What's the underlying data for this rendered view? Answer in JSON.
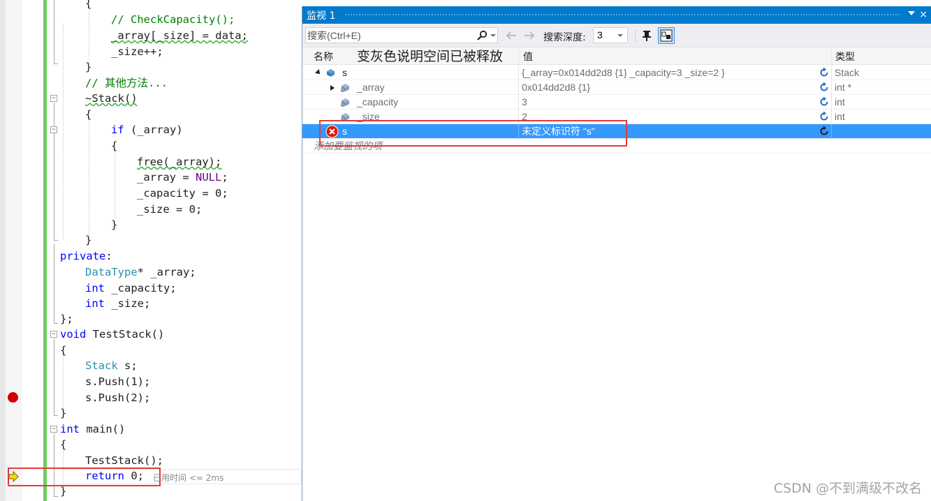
{
  "editor": {
    "lines": [
      {
        "n": 0,
        "parts": [
          {
            "t": "{",
            "c": ""
          }
        ]
      },
      {
        "n": 1,
        "parts": [
          {
            "t": "// CheckCapacity();",
            "c": "cm"
          }
        ]
      },
      {
        "n": 2,
        "parts": [
          {
            "t": "_array[_size] = data;",
            "c": ""
          }
        ]
      },
      {
        "n": 3,
        "parts": [
          {
            "t": "_size++;",
            "c": ""
          }
        ]
      },
      {
        "n": 4,
        "parts": [
          {
            "t": "}",
            "c": ""
          }
        ]
      },
      {
        "n": 5,
        "parts": [
          {
            "t": "// 其他方法...",
            "c": "cm"
          }
        ]
      },
      {
        "n": 6,
        "parts": [
          {
            "t": "~Stack()",
            "c": ""
          }
        ]
      },
      {
        "n": 7,
        "parts": [
          {
            "t": "{",
            "c": ""
          }
        ]
      },
      {
        "n": 8,
        "parts": [
          {
            "t": "if",
            "c": "kw"
          },
          {
            "t": " (_array)",
            "c": ""
          }
        ]
      },
      {
        "n": 9,
        "parts": [
          {
            "t": "{",
            "c": ""
          }
        ]
      },
      {
        "n": 10,
        "parts": [
          {
            "t": "free(_array);",
            "c": ""
          }
        ]
      },
      {
        "n": 11,
        "parts": [
          {
            "t": "_array = ",
            "c": ""
          },
          {
            "t": "NULL",
            "c": "mac"
          },
          {
            "t": ";",
            "c": ""
          }
        ]
      },
      {
        "n": 12,
        "parts": [
          {
            "t": "_capacity = 0;",
            "c": ""
          }
        ]
      },
      {
        "n": 13,
        "parts": [
          {
            "t": "_size = 0;",
            "c": ""
          }
        ]
      },
      {
        "n": 14,
        "parts": [
          {
            "t": "}",
            "c": ""
          }
        ]
      },
      {
        "n": 15,
        "parts": [
          {
            "t": "}",
            "c": ""
          }
        ]
      },
      {
        "n": 16,
        "parts": [
          {
            "t": "private",
            "c": "kw"
          },
          {
            "t": ":",
            "c": ""
          }
        ]
      },
      {
        "n": 17,
        "parts": [
          {
            "t": "DataType",
            "c": "ty"
          },
          {
            "t": "* _array;",
            "c": ""
          }
        ]
      },
      {
        "n": 18,
        "parts": [
          {
            "t": "int",
            "c": "kw"
          },
          {
            "t": " _capacity;",
            "c": ""
          }
        ]
      },
      {
        "n": 19,
        "parts": [
          {
            "t": "int",
            "c": "kw"
          },
          {
            "t": " _size;",
            "c": ""
          }
        ]
      },
      {
        "n": 20,
        "parts": [
          {
            "t": "};",
            "c": ""
          }
        ]
      },
      {
        "n": 21,
        "parts": [
          {
            "t": "void",
            "c": "kw"
          },
          {
            "t": " TestStack()",
            "c": ""
          }
        ]
      },
      {
        "n": 22,
        "parts": [
          {
            "t": "{",
            "c": ""
          }
        ]
      },
      {
        "n": 23,
        "parts": [
          {
            "t": "Stack",
            "c": "ty"
          },
          {
            "t": " s;",
            "c": ""
          }
        ]
      },
      {
        "n": 24,
        "parts": [
          {
            "t": "s.Push(1);",
            "c": ""
          }
        ]
      },
      {
        "n": 25,
        "parts": [
          {
            "t": "s.Push(2);",
            "c": ""
          }
        ]
      },
      {
        "n": 26,
        "parts": [
          {
            "t": "}",
            "c": ""
          }
        ]
      },
      {
        "n": 27,
        "parts": [
          {
            "t": "int",
            "c": "kw"
          },
          {
            "t": " main()",
            "c": ""
          }
        ]
      },
      {
        "n": 28,
        "parts": [
          {
            "t": "{",
            "c": ""
          }
        ]
      },
      {
        "n": 29,
        "parts": [
          {
            "t": "TestStack();",
            "c": ""
          }
        ]
      },
      {
        "n": 30,
        "parts": [
          {
            "t": "return",
            "c": "kw"
          },
          {
            "t": " 0;",
            "c": ""
          }
        ]
      },
      {
        "n": 31,
        "parts": [
          {
            "t": "}",
            "c": ""
          }
        ]
      }
    ],
    "elapsed_time": "已用时间 <= 2ms"
  },
  "watch": {
    "title": "监视 1",
    "close_glyph": "×",
    "search_placeholder": "搜索(Ctrl+E)",
    "depth_label": "搜索深度:",
    "depth_value": "3",
    "columns": {
      "name": "名称",
      "value": "值",
      "type": "类型"
    },
    "annotation": "变灰色说明空间已被释放",
    "rows": [
      {
        "name": "s",
        "value": "{_array=0x014dd2d8 {1} _capacity=3 _size=2 }",
        "type": "Stack",
        "icon": "object-icon",
        "expander": "open"
      },
      {
        "name": "_array",
        "value": "0x014dd2d8 {1}",
        "type": "int *",
        "icon": "field-icon",
        "expander": "closed"
      },
      {
        "name": "_capacity",
        "value": "3",
        "type": "int",
        "icon": "field-icon",
        "expander": "none"
      },
      {
        "name": "_size",
        "value": "2",
        "type": "int",
        "icon": "field-icon",
        "expander": "none"
      },
      {
        "name": "s",
        "value": "未定义标识符 \"s\"",
        "type": "",
        "icon": "error-icon",
        "expander": "none"
      }
    ],
    "add_watch_placeholder": "添加要监视的项"
  },
  "watermark": "CSDN @不到满级不改名",
  "colors": {
    "title_bar": "#007acc",
    "selection": "#3399ff",
    "annotation_box": "#e03c3c",
    "breakpoint": "#d10000",
    "change_bar": "#6cce5b"
  }
}
